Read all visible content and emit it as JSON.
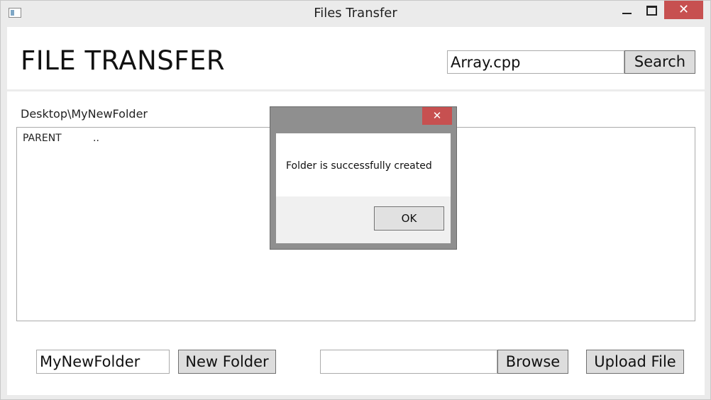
{
  "window": {
    "title": "Files Transfer",
    "close_glyph": "✕"
  },
  "header": {
    "heading": "FILE TRANSFER",
    "search_value": "Array.cpp",
    "search_button": "Search"
  },
  "browser": {
    "current_path": "Desktop\\MyNewFolder",
    "rows": [
      {
        "name": "PARENT",
        "path": ".."
      }
    ]
  },
  "bottom": {
    "folder_name_value": "MyNewFolder",
    "new_folder_button": "New Folder",
    "file_path_value": "",
    "browse_button": "Browse",
    "upload_button": "Upload File"
  },
  "dialog": {
    "close_glyph": "✕",
    "message": "Folder is successfully created",
    "ok_button": "OK"
  },
  "colors": {
    "close_button": "#c75050",
    "button_face": "#dddddd",
    "window_frame": "#ebebeb"
  }
}
